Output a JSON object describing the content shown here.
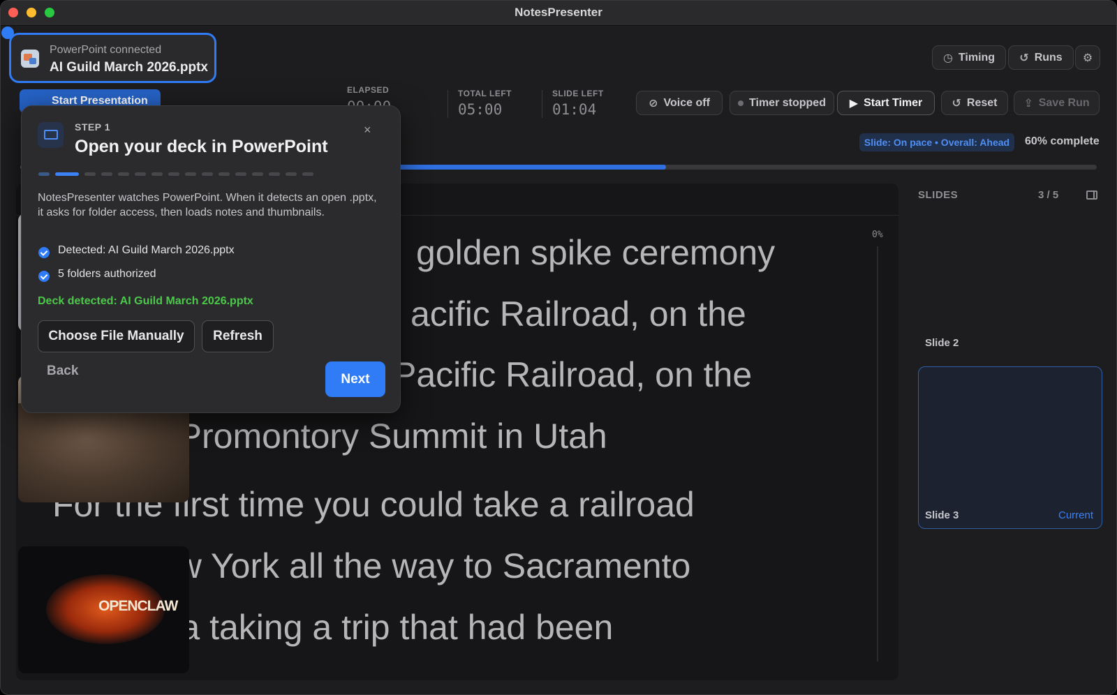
{
  "window": {
    "title": "NotesPresenter"
  },
  "powerpoint": {
    "status": "PowerPoint connected",
    "file": "AI Guild March 2026.pptx"
  },
  "toolbar": {
    "start_presentation": "Start Presentation",
    "timing": "Timing",
    "runs": "Runs",
    "voice": "Voice off",
    "timer_state": "Timer stopped",
    "start_timer": "Start Timer",
    "reset": "Reset",
    "save_run": "Save Run"
  },
  "stats": {
    "elapsed_label": "ELAPSED",
    "elapsed_value": "00:00",
    "total_left_label": "TOTAL LEFT",
    "total_left_value": "05:00",
    "slide_left_label": "SLIDE LEFT",
    "slide_left_value": "01:04"
  },
  "pace": {
    "badge": "Slide: On pace • Overall: Ahead",
    "complete": "60% complete",
    "progress_fraction": 0.6
  },
  "notes": {
    "percent": "0%",
    "lines": [
      "golden spike ceremony",
      "acific Railroad, on the",
      "Pacific Railroad, on the",
      "right, at Promontory Summit in Utah",
      "For the first time you could take a railroad",
      "from New York all the way to Sacramento",
      "California taking a trip that had been"
    ]
  },
  "sidebar": {
    "title": "SLIDES",
    "count": "3 / 5",
    "slides": [
      {
        "label": "Slide 2",
        "tag": ""
      },
      {
        "label": "Slide 3",
        "tag": "Current"
      },
      {
        "label": "",
        "tag": ""
      }
    ],
    "slide4_logo": "OPENCLAW"
  },
  "onboarding": {
    "step": "STEP 1",
    "title": "Open your deck in PowerPoint",
    "step_index": 2,
    "step_total": 16,
    "description": "NotesPresenter watches PowerPoint. When it detects an open .pptx, it asks for folder access, then loads notes and thumbnails.",
    "checks": [
      "Detected: AI Guild March 2026.pptx",
      "5 folders authorized"
    ],
    "deck_status": "Deck detected: AI Guild March 2026.pptx",
    "choose_file": "Choose File Manually",
    "refresh": "Refresh",
    "back": "Back",
    "next": "Next",
    "close": "×"
  },
  "colors": {
    "accent": "#2f7cf6",
    "success": "#4cc84a",
    "background": "#1d1d1f"
  }
}
